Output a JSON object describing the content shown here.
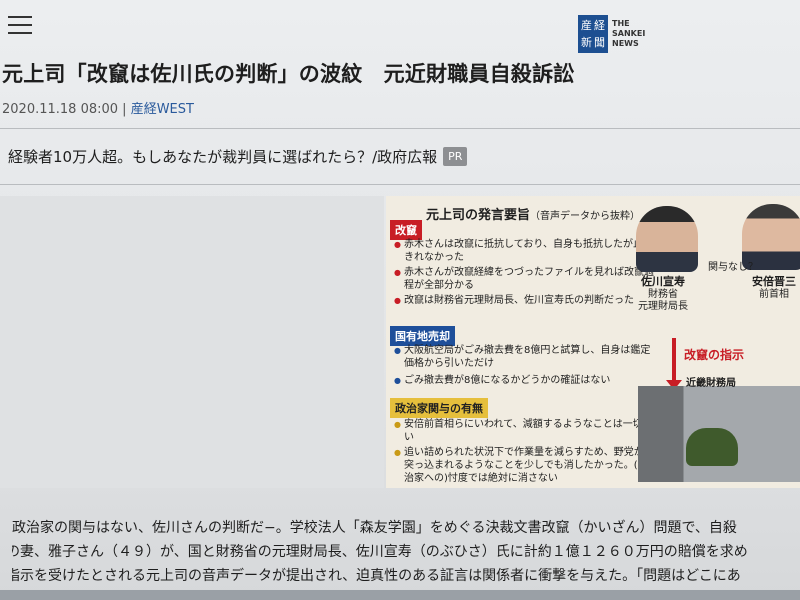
{
  "header": {
    "logo_kanji": [
      "産",
      "経",
      "新",
      "聞"
    ],
    "logo_text": [
      "THE",
      "SANKEI",
      "NEWS"
    ]
  },
  "article": {
    "headline": "元上司「改竄は佐川氏の判断」の波紋　元近財職員自殺訴訟",
    "timestamp": "2020.11.18 08:00",
    "separator": "|",
    "source": "産経WEST"
  },
  "promo": {
    "text": "経験者10万人超。もしあなたが裁判員に選ばれたら？/政府広報",
    "badge": "PR"
  },
  "infographic": {
    "title": "元上司の発言要旨",
    "subtitle": "（音声データから抜粋）",
    "sections": [
      {
        "label": "改竄",
        "items": [
          "赤木さんは改竄に抵抗しており、自身も抵抗したが止めきれなかった",
          "赤木さんが改竄経緯をつづったファイルを見れば改竄過程が全部分かる",
          "改竄は財務省元理財局長、佐川宣寿氏の判断だった"
        ]
      },
      {
        "label": "国有地売却",
        "items": [
          "大阪航空局がごみ撤去費を8億円と試算し、自身は鑑定価格から引いただけ",
          "ごみ撤去費が8億になるかどうかの確証はない"
        ]
      },
      {
        "label": "政治家関与の有無",
        "items": [
          "安倍前首相らにいわれて、減額するようなことは一切ない",
          "追い詰められた状況下で作業量を減らすため、野党から突っ込まれるようなことを少しでも消したかった。(政治家への)忖度では絶対に消さない"
        ]
      }
    ],
    "person1": {
      "name": "佐川宣寿",
      "role1": "財務省",
      "role2": "元理財局長"
    },
    "person2": {
      "name": "安倍晋三",
      "role": "前首相"
    },
    "question": "関与なし？",
    "order_label": "改竄の指示",
    "building_label": "近畿財務局"
  },
  "body": {
    "lines": [
      "政治家の関与はない、佐川さんの判断だ−。学校法人「森友学園」をめぐる決裁文書改竄（かいざん）問題で、自殺",
      "の妻、雅子さん（４９）が、国と財務省の元理財局長、佐川宣寿（のぶひさ）氏に計約１億１２６０万円の賠償を求め",
      "指示を受けたとされる元上司の音声データが提出され、迫真性のある証言は関係者に衝撃を与えた。「問題はどこにあ"
    ]
  }
}
